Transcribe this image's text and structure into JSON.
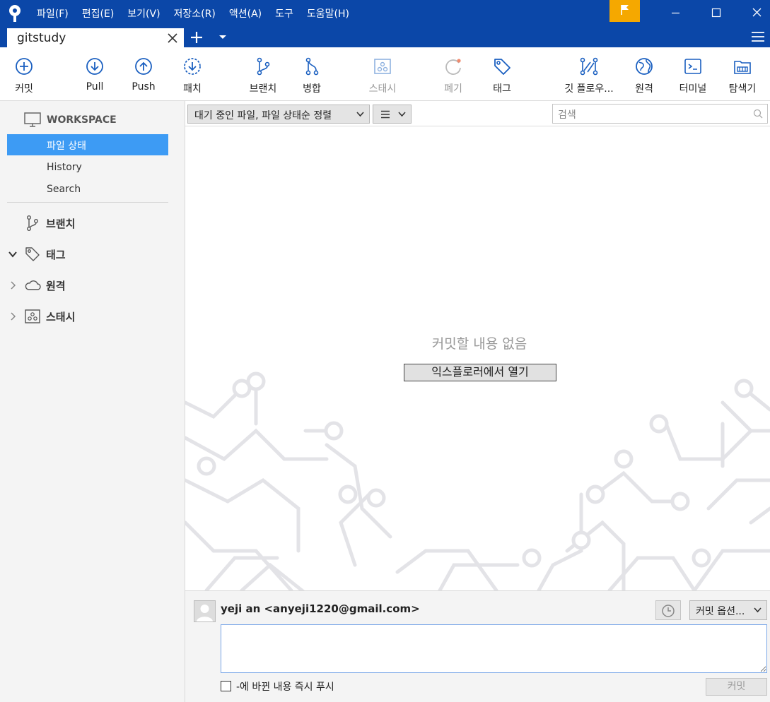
{
  "menu": [
    "파일(F)",
    "편집(E)",
    "보기(V)",
    "저장소(R)",
    "액션(A)",
    "도구",
    "도움말(H)"
  ],
  "tab": {
    "title": "gitstudy"
  },
  "toolbar": {
    "commit": "커밋",
    "pull": "Pull",
    "push": "Push",
    "patch": "패치",
    "branch": "브랜치",
    "merge": "병합",
    "stash": "스태시",
    "discard": "폐기",
    "tag": "태그",
    "gitflow": "깃 플로우...",
    "remote": "원격",
    "terminal": "터미널",
    "explorer": "탐색기"
  },
  "sidebar": {
    "workspace": "WORKSPACE",
    "items": [
      "파일 상태",
      "History",
      "Search"
    ],
    "groups": [
      "브랜치",
      "태그",
      "원격",
      "스태시"
    ]
  },
  "filter": {
    "label": "대기 중인 파일, 파일 상태순 정렬",
    "search_placeholder": "검색"
  },
  "content": {
    "empty_message": "커밋할 내용 없음",
    "open_explorer": "익스플로러에서 열기"
  },
  "commit_panel": {
    "author": "yeji an <anyeji1220@gmail.com>",
    "options": "커밋 옵션...",
    "push_label": "-에 바뀐 내용 즉시 푸시",
    "commit_button": "커밋"
  },
  "colors": {
    "titlebar": "#0b47a8",
    "accent": "#3d9bf4",
    "flag": "#f5a800",
    "icon": "#1a5fc0"
  }
}
